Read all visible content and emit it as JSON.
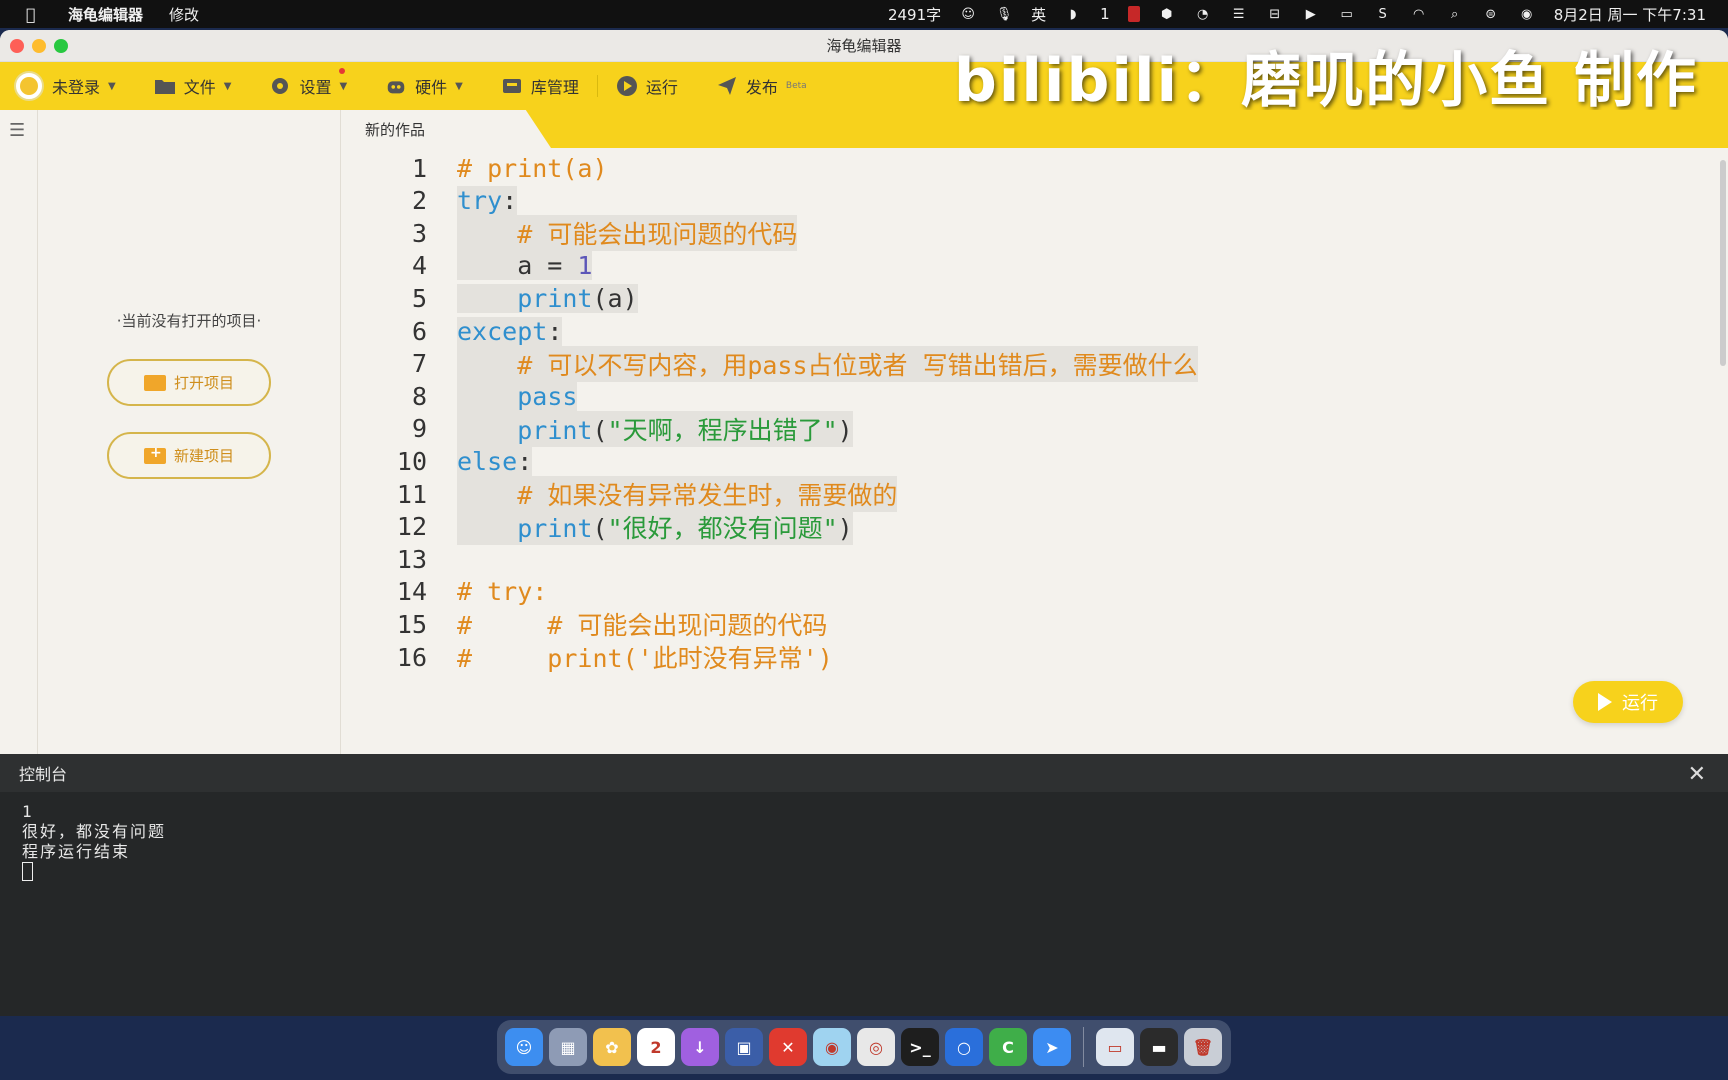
{
  "menubar": {
    "app_name": "海龟编辑器",
    "menu_edit": "修改",
    "word_count": "2491字",
    "input_method": "英",
    "badge_count": "1",
    "datetime": "8月2日 周一 下午7:31"
  },
  "window": {
    "title": "海龟编辑器",
    "watermark": "bilibili：磨叽的小鱼 制作"
  },
  "toolbar": {
    "login": "未登录",
    "file": "文件",
    "settings": "设置",
    "hardware": "硬件",
    "library": "库管理",
    "run": "运行",
    "publish": "发布",
    "publish_badge": "Beta"
  },
  "sidebar": {
    "empty_text": "·当前没有打开的项目·",
    "open_project": "打开项目",
    "new_project": "新建项目"
  },
  "editor": {
    "tab_title": "新的作品",
    "run_button": "运行",
    "lines": [
      {
        "n": "1",
        "parts": [
          {
            "t": "# print(a)",
            "c": "cm"
          }
        ],
        "hl": false
      },
      {
        "n": "2",
        "parts": [
          {
            "t": "try",
            "c": "kw"
          },
          {
            "t": ":",
            "c": ""
          }
        ],
        "hl": true
      },
      {
        "n": "3",
        "parts": [
          {
            "t": "    ",
            "c": ""
          },
          {
            "t": "# 可能会出现问题的代码",
            "c": "cm"
          }
        ],
        "hl": true
      },
      {
        "n": "4",
        "parts": [
          {
            "t": "    a = ",
            "c": ""
          },
          {
            "t": "1",
            "c": "num"
          }
        ],
        "hl": true
      },
      {
        "n": "5",
        "parts": [
          {
            "t": "    ",
            "c": ""
          },
          {
            "t": "print",
            "c": "kw"
          },
          {
            "t": "(a)",
            "c": ""
          }
        ],
        "hl": true
      },
      {
        "n": "6",
        "parts": [
          {
            "t": "except",
            "c": "kw"
          },
          {
            "t": ":",
            "c": ""
          }
        ],
        "hl": true
      },
      {
        "n": "7",
        "parts": [
          {
            "t": "    ",
            "c": ""
          },
          {
            "t": "# 可以不写内容，用pass占位或者 写错出错后，需要做什么",
            "c": "cm"
          }
        ],
        "hl": true
      },
      {
        "n": "8",
        "parts": [
          {
            "t": "    ",
            "c": ""
          },
          {
            "t": "pass",
            "c": "kw"
          }
        ],
        "hl": true
      },
      {
        "n": "9",
        "parts": [
          {
            "t": "    ",
            "c": ""
          },
          {
            "t": "print",
            "c": "kw"
          },
          {
            "t": "(",
            "c": ""
          },
          {
            "t": "\"天啊，程序出错了\"",
            "c": "str"
          },
          {
            "t": ")",
            "c": ""
          }
        ],
        "hl": true
      },
      {
        "n": "10",
        "parts": [
          {
            "t": "else",
            "c": "kw"
          },
          {
            "t": ":",
            "c": ""
          }
        ],
        "hl": true
      },
      {
        "n": "11",
        "parts": [
          {
            "t": "    ",
            "c": ""
          },
          {
            "t": "# 如果没有异常发生时，需要做的",
            "c": "cm"
          }
        ],
        "hl": true
      },
      {
        "n": "12",
        "parts": [
          {
            "t": "    ",
            "c": ""
          },
          {
            "t": "print",
            "c": "kw"
          },
          {
            "t": "(",
            "c": ""
          },
          {
            "t": "\"很好，都没有问题\"",
            "c": "str"
          },
          {
            "t": ")",
            "c": ""
          }
        ],
        "hl": true
      },
      {
        "n": "13",
        "parts": [],
        "hl": false
      },
      {
        "n": "14",
        "parts": [
          {
            "t": "# try:",
            "c": "cm"
          }
        ],
        "hl": false
      },
      {
        "n": "15",
        "parts": [
          {
            "t": "#     # 可能会出现问题的代码",
            "c": "cm"
          }
        ],
        "hl": false
      },
      {
        "n": "16",
        "parts": [
          {
            "t": "#     print('此时没有异常')",
            "c": "cm"
          }
        ],
        "hl": false
      }
    ]
  },
  "console": {
    "title": "控制台",
    "output": [
      "1",
      "很好，都没有问题",
      "程序运行结束"
    ]
  },
  "dock": {
    "apps": [
      {
        "name": "finder-icon",
        "color": "#3d8ef0",
        "glyph": "☺"
      },
      {
        "name": "launchpad-icon",
        "color": "#8e9bb5",
        "glyph": "▦"
      },
      {
        "name": "photos-icon",
        "color": "#f2c14e",
        "glyph": "✿"
      },
      {
        "name": "calendar-icon",
        "color": "#ffffff",
        "glyph": "2"
      },
      {
        "name": "downloads-icon",
        "color": "#a060e0",
        "glyph": "↓"
      },
      {
        "name": "screen-app-icon",
        "color": "#3b5ea8",
        "glyph": "▣"
      },
      {
        "name": "xmind-icon",
        "color": "#e03a2f",
        "glyph": "✕"
      },
      {
        "name": "turtle-editor-icon",
        "color": "#9fd3f0",
        "glyph": "◉"
      },
      {
        "name": "chrome-icon",
        "color": "#e8e8e8",
        "glyph": "◎"
      },
      {
        "name": "terminal-icon",
        "color": "#1e1e1e",
        "glyph": ">_"
      },
      {
        "name": "qq-icon",
        "color": "#2a6fdb",
        "glyph": "○"
      },
      {
        "name": "camtasia-icon",
        "color": "#3fae49",
        "glyph": "C"
      },
      {
        "name": "feishu-icon",
        "color": "#3c8cf2",
        "glyph": "➤"
      },
      {
        "name": "preview-window-icon",
        "color": "#dfe6ef",
        "glyph": "▭"
      },
      {
        "name": "screen-recorder-icon",
        "color": "#2b2b2b",
        "glyph": "▬"
      },
      {
        "name": "trash-icon",
        "color": "#c9ced6",
        "glyph": "🗑"
      }
    ]
  }
}
